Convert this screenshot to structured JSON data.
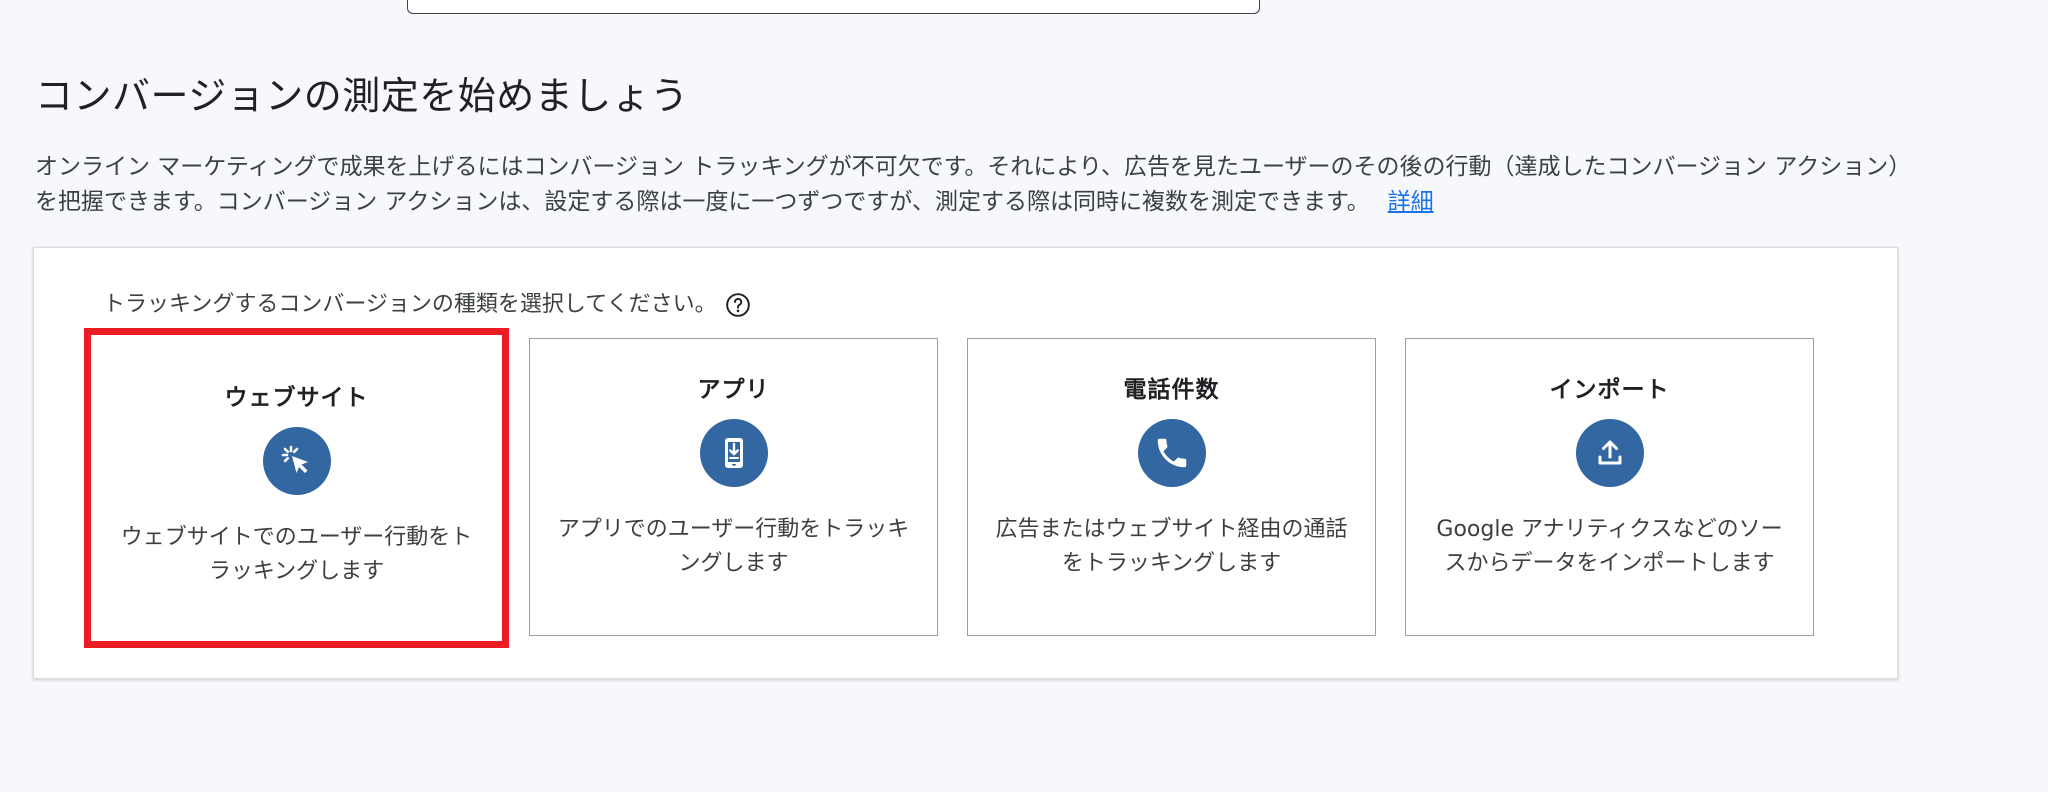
{
  "page": {
    "title": "コンバージョンの測定を始めましょう",
    "intro": "オンライン マーケティングで成果を上げるにはコンバージョン トラッキングが不可欠です。それにより、広告を見たユーザーのその後の行動（達成したコンバージョン アクション）を把握できます。コンバージョン アクションは、設定する際は一度に一つずつですが、測定する際は同時に複数を測定できます。",
    "learn_more": "詳細"
  },
  "panel": {
    "prompt": "トラッキングするコンバージョンの種類を選択してください。",
    "help_icon": "help-circle-icon"
  },
  "cards": [
    {
      "title": "ウェブサイト",
      "description": "ウェブサイトでのユーザー行動をトラッキングします",
      "icon": "click-cursor-icon",
      "selected": true
    },
    {
      "title": "アプリ",
      "description": "アプリでのユーザー行動をトラッキングします",
      "icon": "phone-download-icon",
      "selected": false
    },
    {
      "title": "電話件数",
      "description": "広告またはウェブサイト経由の通話をトラッキングします",
      "icon": "phone-call-icon",
      "selected": false
    },
    {
      "title": "インポート",
      "description": "Google アナリティクスなどのソースからデータをインポートします",
      "icon": "upload-icon",
      "selected": false
    }
  ],
  "colors": {
    "accent": "#3367a1",
    "selection": "#ea1c24",
    "link": "#1a73e8"
  }
}
